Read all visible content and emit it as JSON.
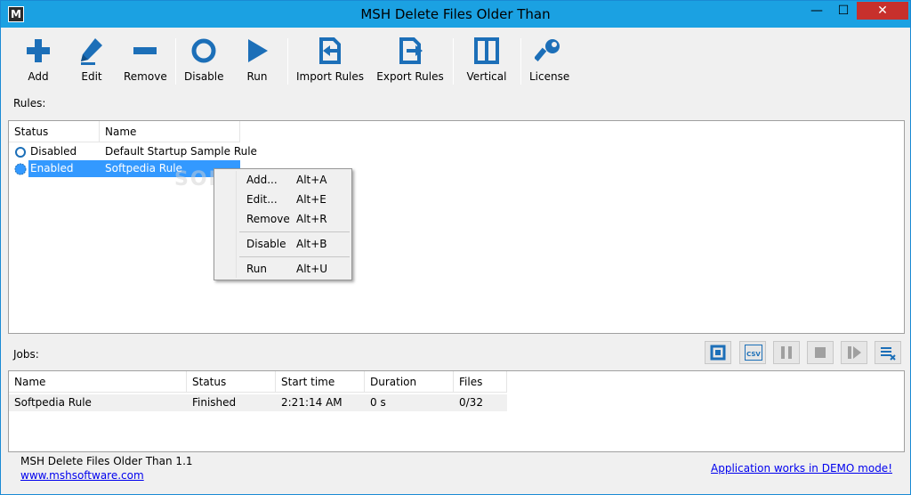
{
  "window": {
    "title": "MSH Delete Files Older Than",
    "icon_letter": "M",
    "controls": {
      "minimize": "—",
      "maximize": "☐",
      "close": "✕"
    }
  },
  "toolbar": {
    "buttons": [
      {
        "label": "Add",
        "icon": "plus-icon"
      },
      {
        "label": "Edit",
        "icon": "pencil-icon"
      },
      {
        "label": "Remove",
        "icon": "minus-icon"
      },
      {
        "label": "Disable",
        "icon": "circle-icon"
      },
      {
        "label": "Run",
        "icon": "play-icon"
      },
      {
        "label": "Import Rules",
        "icon": "import-icon"
      },
      {
        "label": "Export Rules",
        "icon": "export-icon"
      },
      {
        "label": "Vertical",
        "icon": "vertical-split-icon"
      },
      {
        "label": "License",
        "icon": "key-icon"
      }
    ]
  },
  "rules": {
    "label": "Rules:",
    "columns": [
      "Status",
      "Name"
    ],
    "rows": [
      {
        "status": "Disabled",
        "name": "Default Startup Sample Rule",
        "selected": false
      },
      {
        "status": "Enabled",
        "name": "Softpedia Rule",
        "selected": true
      }
    ]
  },
  "context_menu": {
    "items": [
      {
        "label": "Add...",
        "shortcut": "Alt+A"
      },
      {
        "label": "Edit...",
        "shortcut": "Alt+E"
      },
      {
        "label": "Remove",
        "shortcut": "Alt+R"
      },
      {
        "label": "Disable",
        "shortcut": "Alt+B"
      },
      {
        "label": "Run",
        "shortcut": "Alt+U"
      }
    ]
  },
  "jobs": {
    "label": "Jobs:",
    "toolbar_icons": [
      "save-icon",
      "csv-icon",
      "pause-icon",
      "stop-icon",
      "resume-icon",
      "clear-list-icon"
    ],
    "csv_text": "CSV",
    "columns": [
      "Name",
      "Status",
      "Start time",
      "Duration",
      "Files"
    ],
    "rows": [
      {
        "name": "Softpedia Rule",
        "status": "Finished",
        "start": "2:21:14 AM",
        "duration": "0 s",
        "files": "0/32"
      }
    ]
  },
  "status_bar": {
    "version": "MSH Delete Files Older Than 1.1",
    "website": "www.mshsoftware.com",
    "demo": "Application works in DEMO mode!"
  },
  "watermark": "SOFTPEDIA",
  "colors": {
    "accent": "#1ba1e2",
    "icon_blue": "#1c6fb8",
    "selection": "#3399ff",
    "close": "#c7302c"
  }
}
